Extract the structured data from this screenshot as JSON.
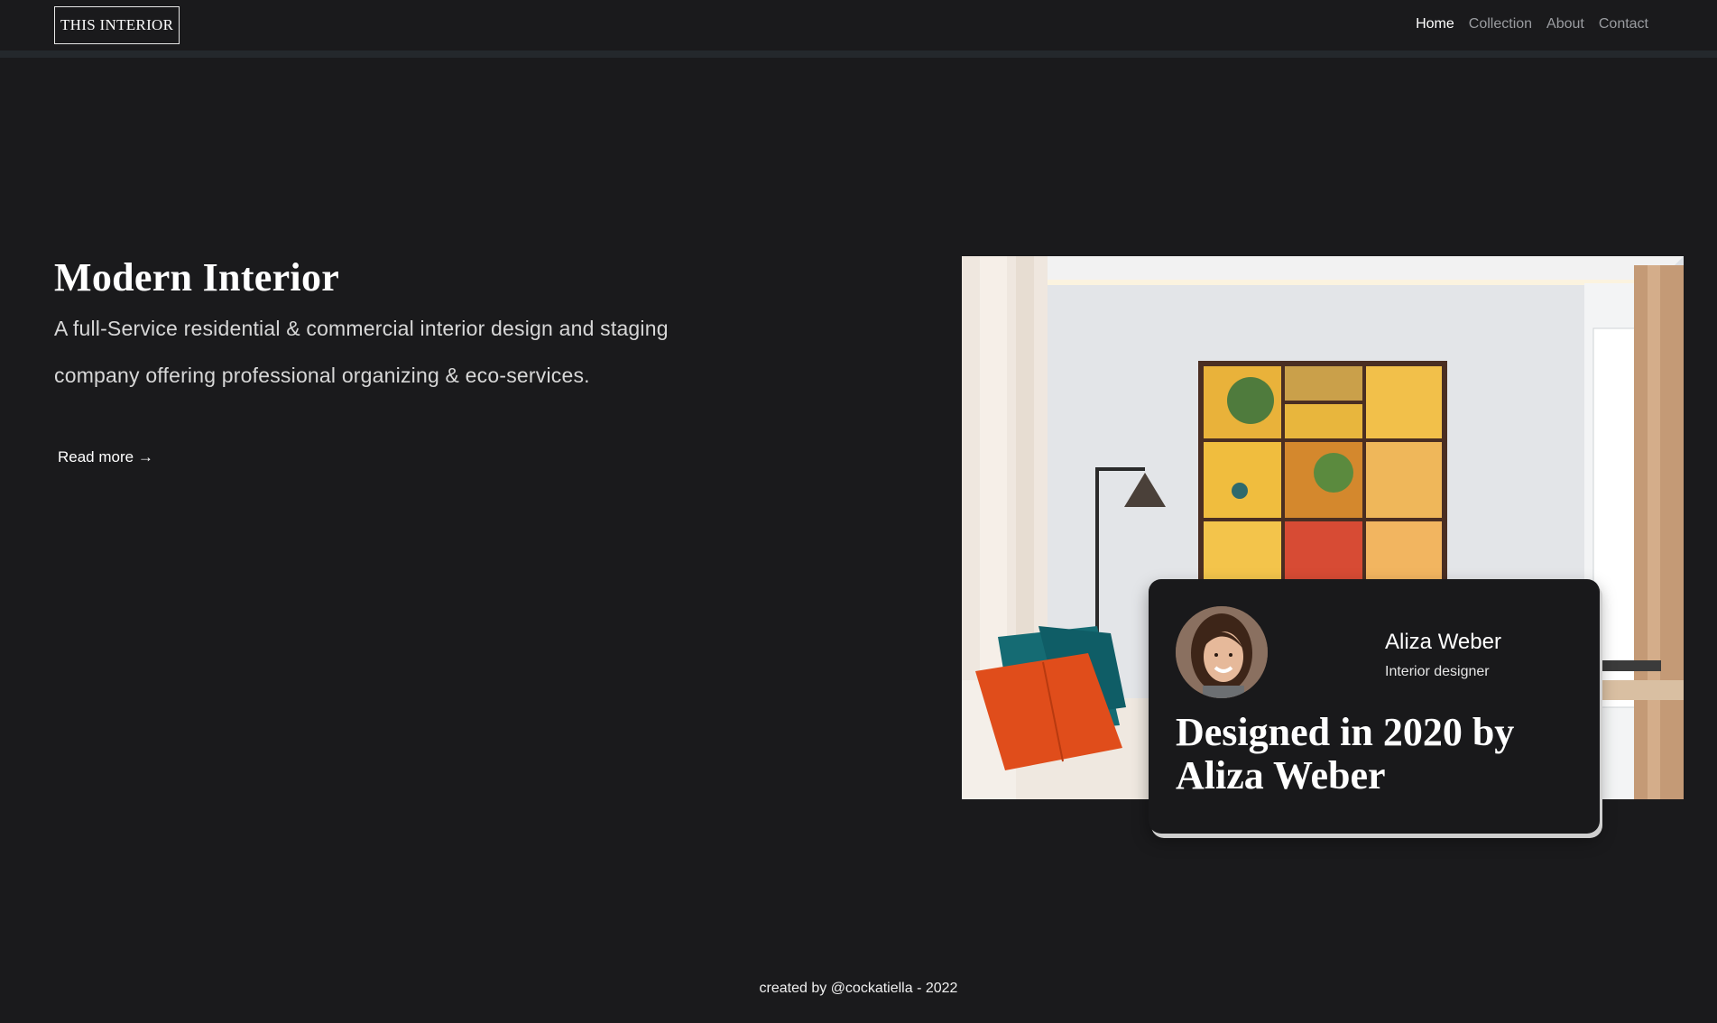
{
  "nav": {
    "brand": "THIS INTERIOR",
    "links": [
      "Home",
      "Collection",
      "About",
      "Contact"
    ],
    "active": "Home"
  },
  "hero": {
    "title": "Modern Interior",
    "description": "A full-Service residential & commercial interior design and staging company offering professional organizing & eco-services.",
    "read_more": "Read more →"
  },
  "card": {
    "name": "Aliza Weber",
    "role": "Interior designer",
    "headline": "Designed in 2020 by Aliza Weber"
  },
  "footer": {
    "credit": "created by @cockatiella - 2022"
  },
  "colors": {
    "background": "#1a1a1c",
    "nav_inactive": "#9a9ca0",
    "text": "#ffffff"
  }
}
